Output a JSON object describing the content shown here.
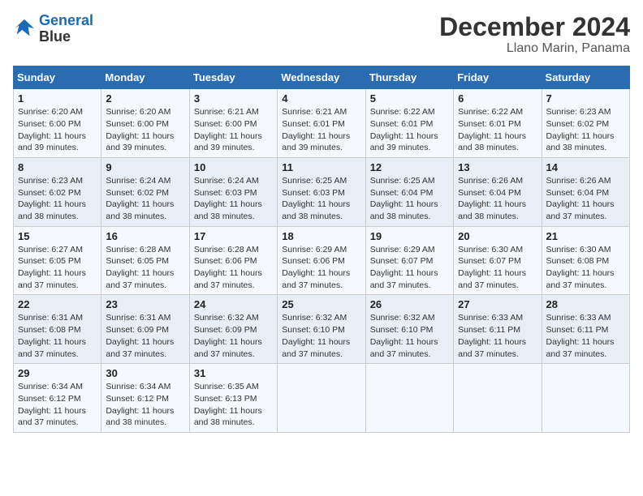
{
  "header": {
    "logo_line1": "General",
    "logo_line2": "Blue",
    "title": "December 2024",
    "subtitle": "Llano Marin, Panama"
  },
  "weekdays": [
    "Sunday",
    "Monday",
    "Tuesday",
    "Wednesday",
    "Thursday",
    "Friday",
    "Saturday"
  ],
  "weeks": [
    [
      {
        "day": "1",
        "sunrise": "6:20 AM",
        "sunset": "6:00 PM",
        "daylight": "11 hours and 39 minutes."
      },
      {
        "day": "2",
        "sunrise": "6:20 AM",
        "sunset": "6:00 PM",
        "daylight": "11 hours and 39 minutes."
      },
      {
        "day": "3",
        "sunrise": "6:21 AM",
        "sunset": "6:00 PM",
        "daylight": "11 hours and 39 minutes."
      },
      {
        "day": "4",
        "sunrise": "6:21 AM",
        "sunset": "6:01 PM",
        "daylight": "11 hours and 39 minutes."
      },
      {
        "day": "5",
        "sunrise": "6:22 AM",
        "sunset": "6:01 PM",
        "daylight": "11 hours and 39 minutes."
      },
      {
        "day": "6",
        "sunrise": "6:22 AM",
        "sunset": "6:01 PM",
        "daylight": "11 hours and 38 minutes."
      },
      {
        "day": "7",
        "sunrise": "6:23 AM",
        "sunset": "6:02 PM",
        "daylight": "11 hours and 38 minutes."
      }
    ],
    [
      {
        "day": "8",
        "sunrise": "6:23 AM",
        "sunset": "6:02 PM",
        "daylight": "11 hours and 38 minutes."
      },
      {
        "day": "9",
        "sunrise": "6:24 AM",
        "sunset": "6:02 PM",
        "daylight": "11 hours and 38 minutes."
      },
      {
        "day": "10",
        "sunrise": "6:24 AM",
        "sunset": "6:03 PM",
        "daylight": "11 hours and 38 minutes."
      },
      {
        "day": "11",
        "sunrise": "6:25 AM",
        "sunset": "6:03 PM",
        "daylight": "11 hours and 38 minutes."
      },
      {
        "day": "12",
        "sunrise": "6:25 AM",
        "sunset": "6:04 PM",
        "daylight": "11 hours and 38 minutes."
      },
      {
        "day": "13",
        "sunrise": "6:26 AM",
        "sunset": "6:04 PM",
        "daylight": "11 hours and 38 minutes."
      },
      {
        "day": "14",
        "sunrise": "6:26 AM",
        "sunset": "6:04 PM",
        "daylight": "11 hours and 37 minutes."
      }
    ],
    [
      {
        "day": "15",
        "sunrise": "6:27 AM",
        "sunset": "6:05 PM",
        "daylight": "11 hours and 37 minutes."
      },
      {
        "day": "16",
        "sunrise": "6:28 AM",
        "sunset": "6:05 PM",
        "daylight": "11 hours and 37 minutes."
      },
      {
        "day": "17",
        "sunrise": "6:28 AM",
        "sunset": "6:06 PM",
        "daylight": "11 hours and 37 minutes."
      },
      {
        "day": "18",
        "sunrise": "6:29 AM",
        "sunset": "6:06 PM",
        "daylight": "11 hours and 37 minutes."
      },
      {
        "day": "19",
        "sunrise": "6:29 AM",
        "sunset": "6:07 PM",
        "daylight": "11 hours and 37 minutes."
      },
      {
        "day": "20",
        "sunrise": "6:30 AM",
        "sunset": "6:07 PM",
        "daylight": "11 hours and 37 minutes."
      },
      {
        "day": "21",
        "sunrise": "6:30 AM",
        "sunset": "6:08 PM",
        "daylight": "11 hours and 37 minutes."
      }
    ],
    [
      {
        "day": "22",
        "sunrise": "6:31 AM",
        "sunset": "6:08 PM",
        "daylight": "11 hours and 37 minutes."
      },
      {
        "day": "23",
        "sunrise": "6:31 AM",
        "sunset": "6:09 PM",
        "daylight": "11 hours and 37 minutes."
      },
      {
        "day": "24",
        "sunrise": "6:32 AM",
        "sunset": "6:09 PM",
        "daylight": "11 hours and 37 minutes."
      },
      {
        "day": "25",
        "sunrise": "6:32 AM",
        "sunset": "6:10 PM",
        "daylight": "11 hours and 37 minutes."
      },
      {
        "day": "26",
        "sunrise": "6:32 AM",
        "sunset": "6:10 PM",
        "daylight": "11 hours and 37 minutes."
      },
      {
        "day": "27",
        "sunrise": "6:33 AM",
        "sunset": "6:11 PM",
        "daylight": "11 hours and 37 minutes."
      },
      {
        "day": "28",
        "sunrise": "6:33 AM",
        "sunset": "6:11 PM",
        "daylight": "11 hours and 37 minutes."
      }
    ],
    [
      {
        "day": "29",
        "sunrise": "6:34 AM",
        "sunset": "6:12 PM",
        "daylight": "11 hours and 37 minutes."
      },
      {
        "day": "30",
        "sunrise": "6:34 AM",
        "sunset": "6:12 PM",
        "daylight": "11 hours and 38 minutes."
      },
      {
        "day": "31",
        "sunrise": "6:35 AM",
        "sunset": "6:13 PM",
        "daylight": "11 hours and 38 minutes."
      },
      null,
      null,
      null,
      null
    ]
  ]
}
